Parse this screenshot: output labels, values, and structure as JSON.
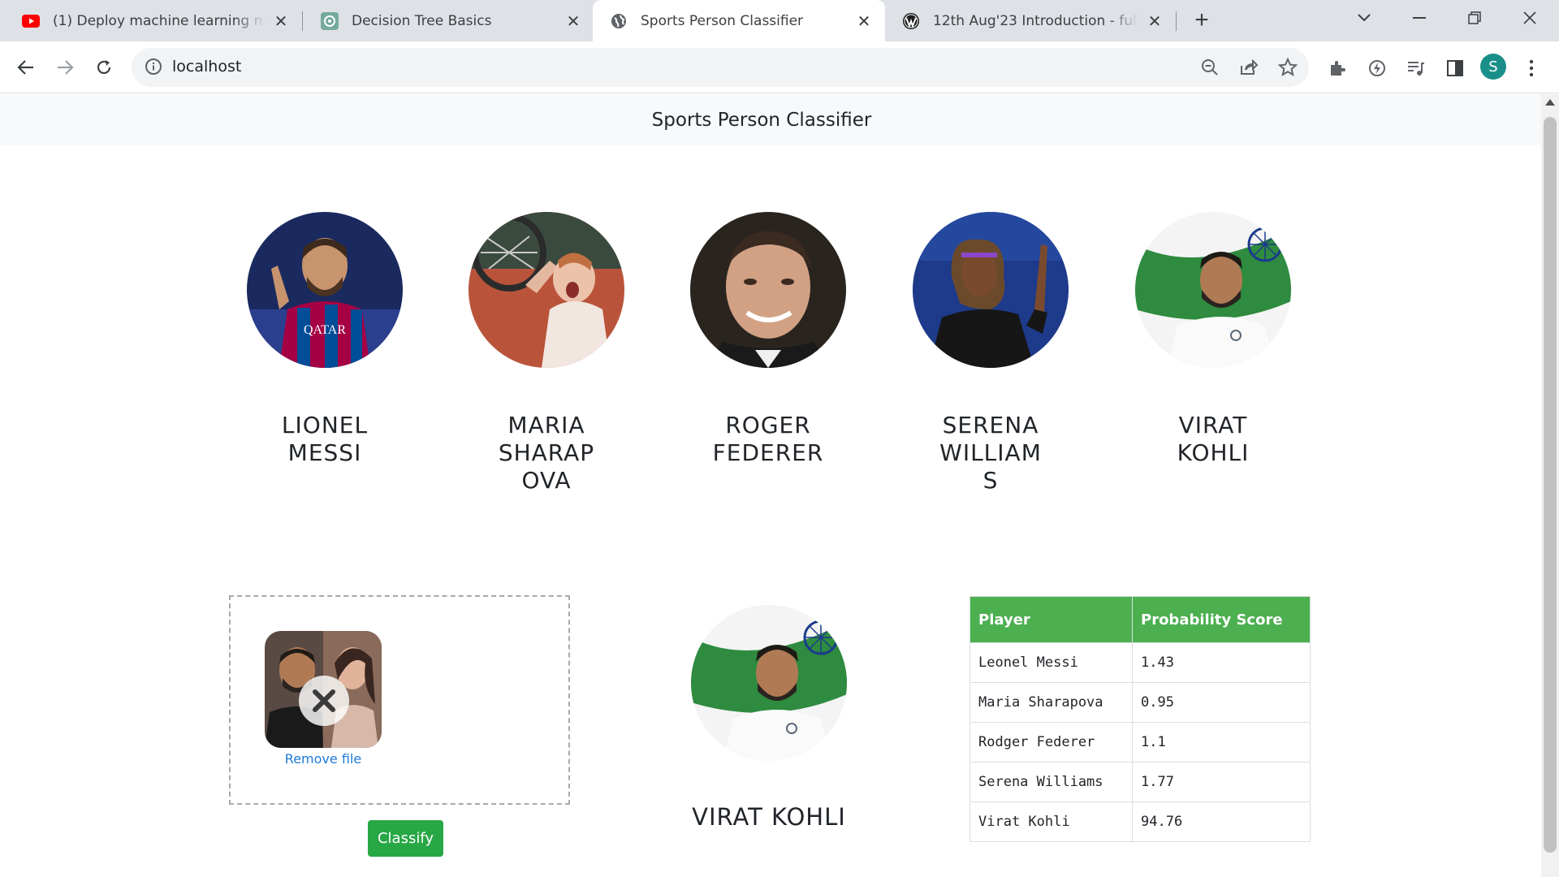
{
  "browser": {
    "tabs": [
      {
        "title": "(1) Deploy machine learning mo",
        "favicon": "youtube-icon",
        "active": false
      },
      {
        "title": "Decision Tree Basics",
        "favicon": "chatgpt-icon",
        "active": false
      },
      {
        "title": "Sports Person Classifier",
        "favicon": "globe-icon",
        "active": true
      },
      {
        "title": "12th Aug'23 Introduction - full s",
        "favicon": "wordpress-icon",
        "active": false
      }
    ],
    "url": "localhost",
    "profile_initial": "S",
    "colors": {
      "tabbar": "#dee1e6",
      "profile": "#1a8f8a"
    }
  },
  "page": {
    "brand": "Sports Person Classifier",
    "players": [
      {
        "name": "LIONEL MESSI",
        "photo": "messi-photo"
      },
      {
        "name": "MARIA SHARAPOVA",
        "photo": "sharapova-photo"
      },
      {
        "name": "ROGER FEDERER",
        "photo": "federer-photo"
      },
      {
        "name": "SERENA WILLIAMS",
        "photo": "serena-photo"
      },
      {
        "name": "VIRAT KOHLI",
        "photo": "kohli-photo"
      }
    ],
    "upload": {
      "remove_label": "Remove file",
      "classify_label": "Classify"
    },
    "result": {
      "name": "VIRAT KOHLI"
    },
    "table": {
      "headers": [
        "Player",
        "Probability Score"
      ],
      "rows": [
        [
          "Leonel Messi",
          "1.43"
        ],
        [
          "Maria Sharapova",
          "0.95"
        ],
        [
          "Rodger Federer",
          "1.1"
        ],
        [
          "Serena Williams",
          "1.77"
        ],
        [
          "Virat Kohli",
          "94.76"
        ]
      ]
    },
    "colors": {
      "header_bg": "#4caf50",
      "button": "#28a745",
      "link": "#1f7ad9",
      "navbar": "#f8f9fa"
    }
  }
}
